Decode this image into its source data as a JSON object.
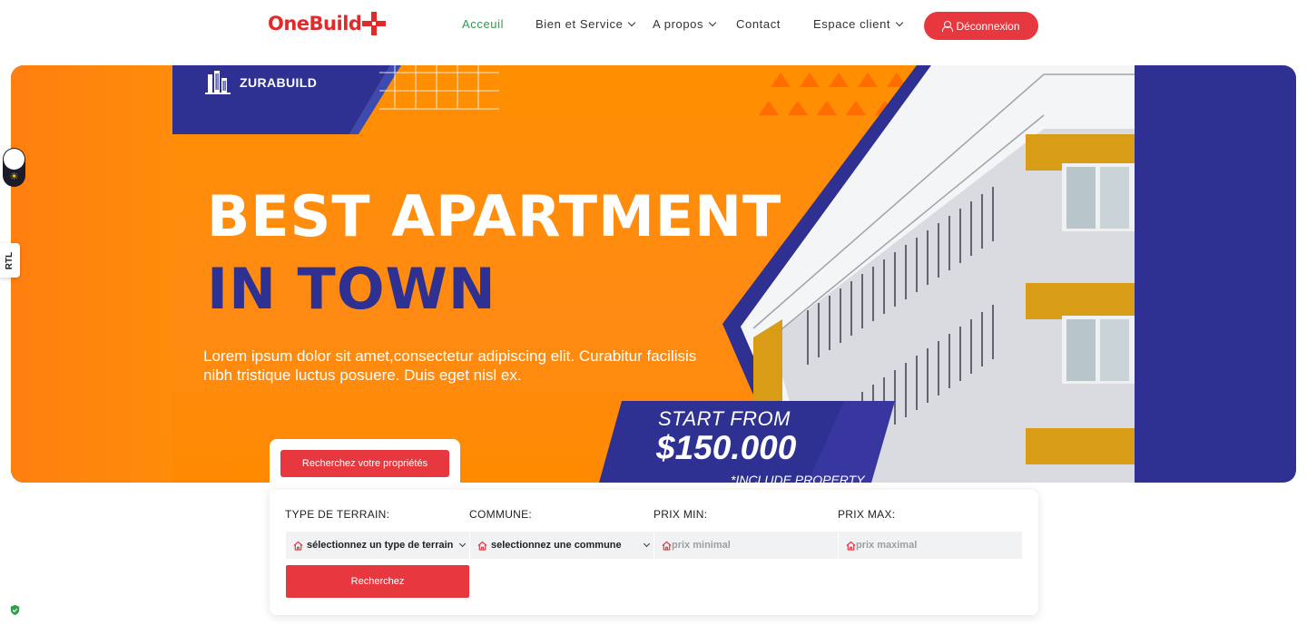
{
  "logo": {
    "part1": "One",
    "part2": "Build"
  },
  "nav": {
    "items": [
      {
        "label": "Acceuil",
        "active": true
      },
      {
        "label": "Bien et Service",
        "dropdown": true
      },
      {
        "label": "A propos",
        "dropdown": true
      },
      {
        "label": "Contact"
      },
      {
        "label": "Espace client",
        "dropdown": true
      }
    ],
    "logout_label": "Déconnexion"
  },
  "hero": {
    "brand": "ZURABUILD",
    "headline_line1": "BEST APARTMENT",
    "headline_line2": "IN TOWN",
    "description": "Lorem ipsum dolor sit amet,consectetur  adipiscing elit. Curabitur facilisis nibh tristique luctus posuere. Duis eget nisl ex.",
    "price_prefix": "START FROM",
    "price_value": "$150.000",
    "price_note": "*INCLUDE PROPERTY"
  },
  "sidebar": {
    "rtl_label": "RTL"
  },
  "search": {
    "tab_label": "Recherchez votre propriétés",
    "fields": [
      {
        "label": "TYPE DE TERRAIN:",
        "value": "sélectionnez un type de terrain",
        "kind": "select"
      },
      {
        "label": "COMMUNE:",
        "value": "selectionnez une commune",
        "kind": "select"
      },
      {
        "label": "PRIX MIN:",
        "placeholder": "prix minimal",
        "kind": "input"
      },
      {
        "label": "PRIX MAX:",
        "placeholder": "prix maximal",
        "kind": "input"
      }
    ],
    "submit_label": "Recherchez"
  },
  "colors": {
    "accent_red": "#e6383e",
    "active_green": "#2e9d4e",
    "hero_orange": "#ff8a00",
    "hero_navy": "#2e3192"
  }
}
